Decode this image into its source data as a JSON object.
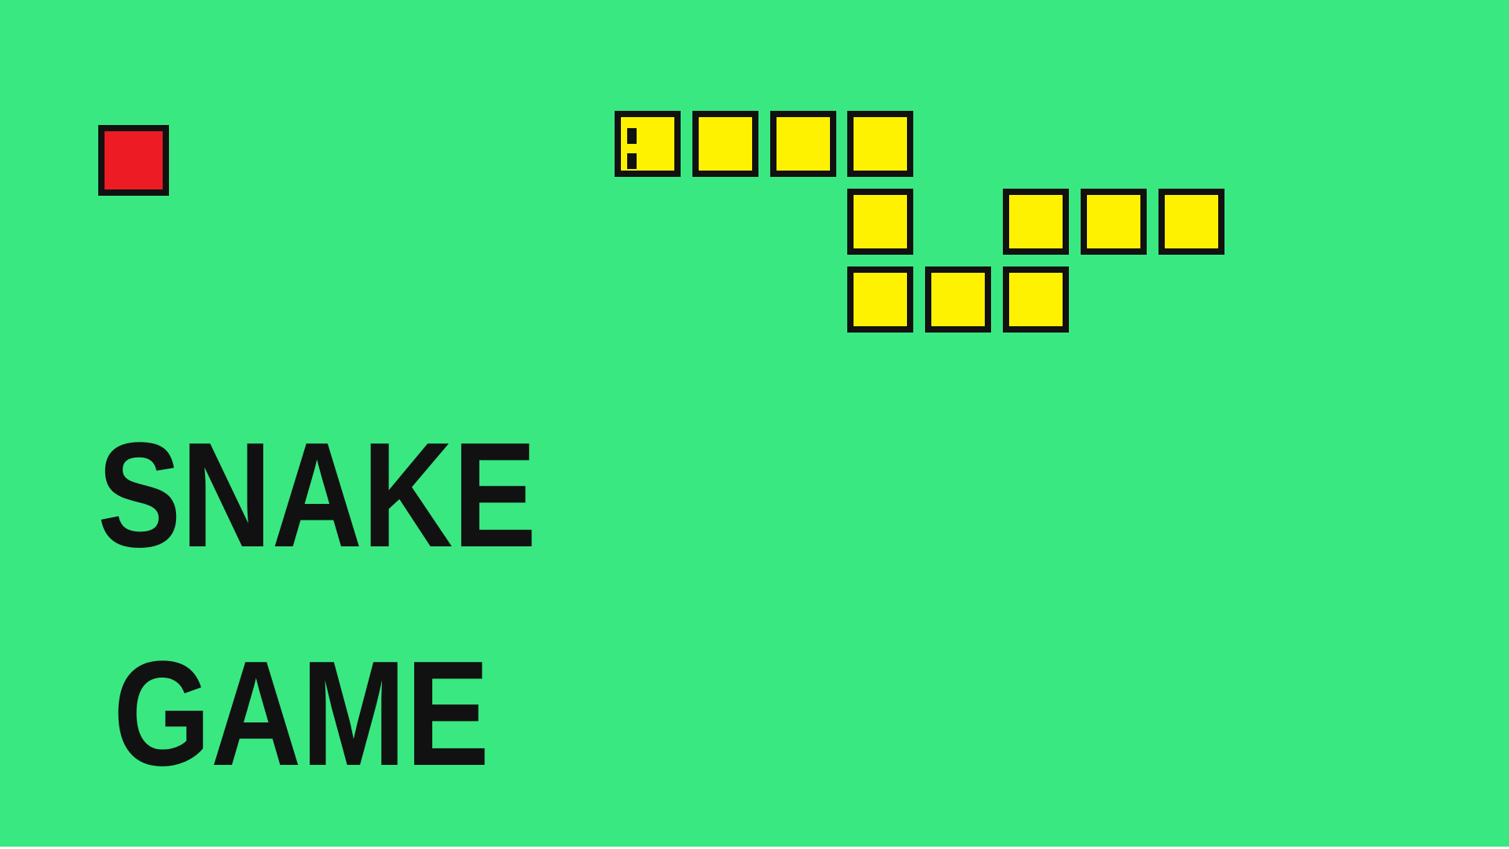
{
  "colors": {
    "background": "#3ae882",
    "food": "#ed1c24",
    "snake_body": "#fff200",
    "outline": "#111111"
  },
  "title": {
    "line1": "SNAKE",
    "line2": "GAME"
  },
  "board": {
    "cols": 20,
    "rows": 11
  },
  "food": {
    "col": 1,
    "row": 1
  },
  "snake": {
    "head_direction": "left",
    "segments": [
      {
        "col": 8,
        "row": 1
      },
      {
        "col": 9,
        "row": 1
      },
      {
        "col": 10,
        "row": 1
      },
      {
        "col": 11,
        "row": 1
      },
      {
        "col": 11,
        "row": 2
      },
      {
        "col": 11,
        "row": 3
      },
      {
        "col": 12,
        "row": 3
      },
      {
        "col": 13,
        "row": 3
      },
      {
        "col": 13,
        "row": 2
      },
      {
        "col": 14,
        "row": 2
      },
      {
        "col": 15,
        "row": 2
      }
    ]
  }
}
